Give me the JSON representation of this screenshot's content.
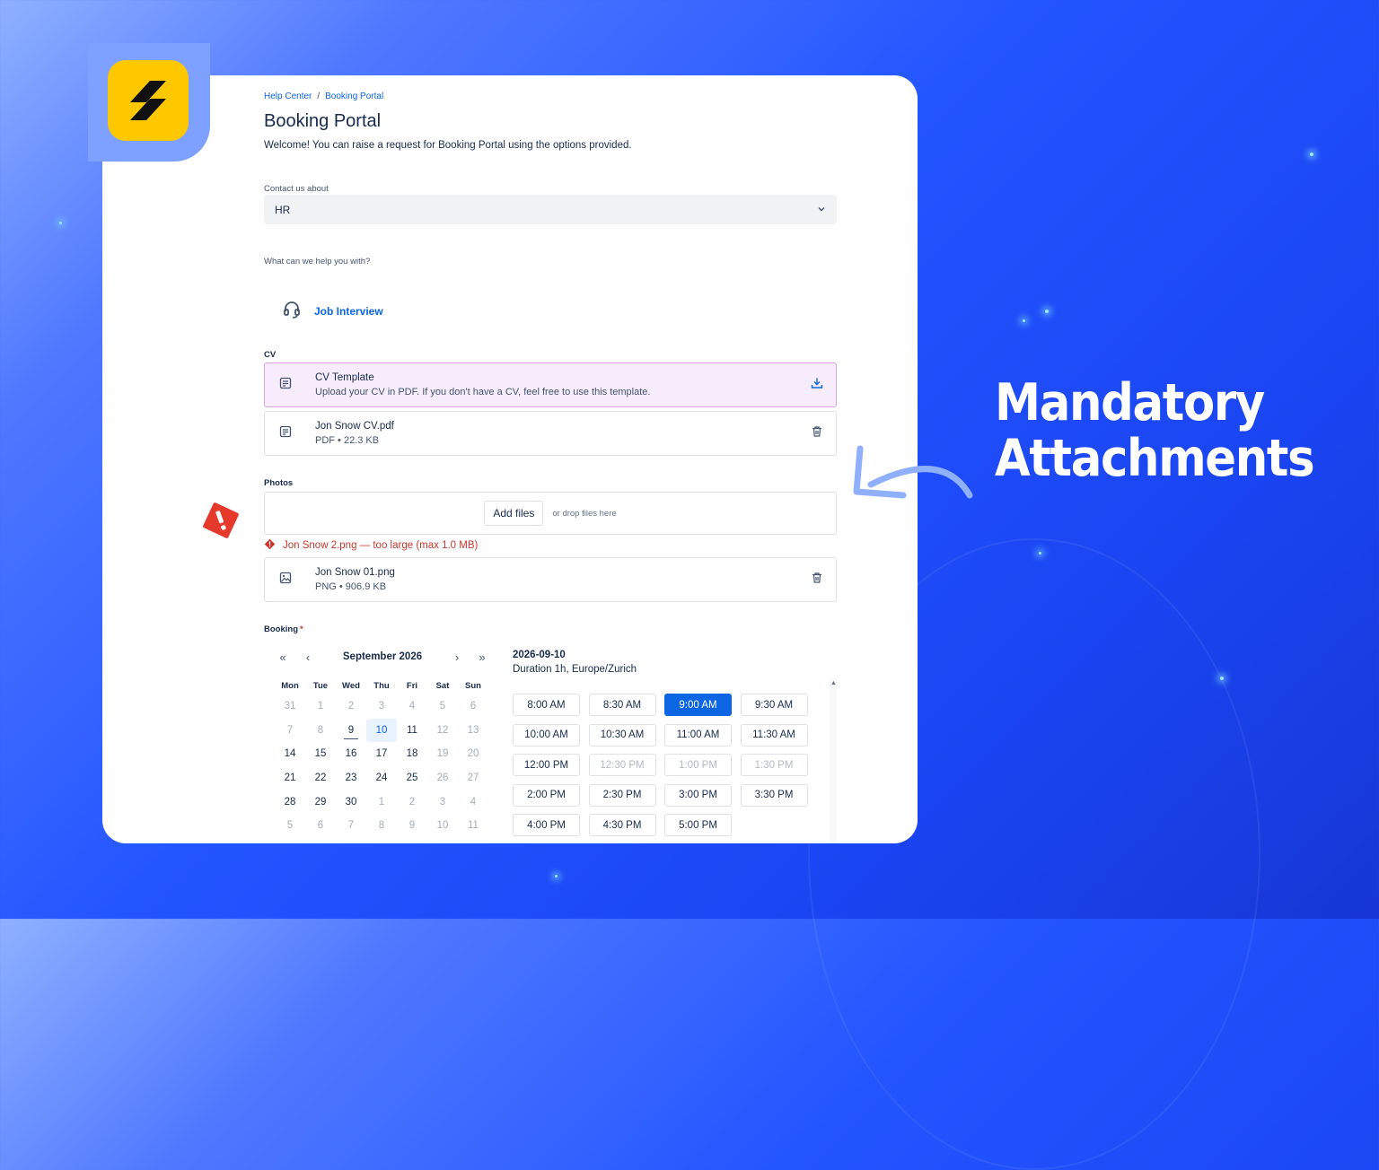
{
  "breadcrumbs": [
    "Help Center",
    "Booking Portal"
  ],
  "page": {
    "title": "Booking Portal",
    "welcome": "Welcome! You can raise a request for Booking Portal using the options provided."
  },
  "contact": {
    "label": "Contact us about",
    "value": "HR"
  },
  "help": {
    "label": "What can we help you with?",
    "request_type": "Job Interview",
    "icon": "headset-icon"
  },
  "cv": {
    "label": "CV",
    "template": {
      "name": "CV Template",
      "description": "Upload your CV in PDF. If you don't have a CV, feel free to use this template."
    },
    "file": {
      "name": "Jon Snow CV.pdf",
      "meta": "PDF • 22.3 KB"
    }
  },
  "photos": {
    "label": "Photos",
    "add_button": "Add files",
    "drop_hint": "or drop files here",
    "error": "Jon Snow 2.png — too large (max 1.0 MB)",
    "file": {
      "name": "Jon Snow 01.png",
      "meta": "PNG • 906.9 KB"
    }
  },
  "booking": {
    "label": "Booking",
    "required_mark": "*",
    "month": "September 2026",
    "nav": {
      "prev_year": "«",
      "prev_month": "‹",
      "next_month": "›",
      "next_year": "»"
    },
    "weekdays": [
      "Mon",
      "Tue",
      "Wed",
      "Thu",
      "Fri",
      "Sat",
      "Sun"
    ],
    "days": [
      {
        "d": "31",
        "s": "dim"
      },
      {
        "d": "1",
        "s": "dim"
      },
      {
        "d": "2",
        "s": "dim"
      },
      {
        "d": "3",
        "s": "dim"
      },
      {
        "d": "4",
        "s": "dim"
      },
      {
        "d": "5",
        "s": "dim"
      },
      {
        "d": "6",
        "s": "dim"
      },
      {
        "d": "7",
        "s": "dim"
      },
      {
        "d": "8",
        "s": "dim"
      },
      {
        "d": "9",
        "s": "today"
      },
      {
        "d": "10",
        "s": "sel"
      },
      {
        "d": "11",
        "s": ""
      },
      {
        "d": "12",
        "s": "dim"
      },
      {
        "d": "13",
        "s": "dim"
      },
      {
        "d": "14",
        "s": ""
      },
      {
        "d": "15",
        "s": ""
      },
      {
        "d": "16",
        "s": ""
      },
      {
        "d": "17",
        "s": ""
      },
      {
        "d": "18",
        "s": ""
      },
      {
        "d": "19",
        "s": "dim"
      },
      {
        "d": "20",
        "s": "dim"
      },
      {
        "d": "21",
        "s": ""
      },
      {
        "d": "22",
        "s": ""
      },
      {
        "d": "23",
        "s": ""
      },
      {
        "d": "24",
        "s": ""
      },
      {
        "d": "25",
        "s": ""
      },
      {
        "d": "26",
        "s": "dim"
      },
      {
        "d": "27",
        "s": "dim"
      },
      {
        "d": "28",
        "s": ""
      },
      {
        "d": "29",
        "s": ""
      },
      {
        "d": "30",
        "s": ""
      },
      {
        "d": "1",
        "s": "dim"
      },
      {
        "d": "2",
        "s": "dim"
      },
      {
        "d": "3",
        "s": "dim"
      },
      {
        "d": "4",
        "s": "dim"
      },
      {
        "d": "5",
        "s": "dim"
      },
      {
        "d": "6",
        "s": "dim"
      },
      {
        "d": "7",
        "s": "dim"
      },
      {
        "d": "8",
        "s": "dim"
      },
      {
        "d": "9",
        "s": "dim"
      },
      {
        "d": "10",
        "s": "dim"
      },
      {
        "d": "11",
        "s": "dim"
      }
    ],
    "selected_date": "2026-09-10",
    "duration": "Duration 1h, Europe/Zurich",
    "slots": [
      {
        "t": "8:00 AM",
        "s": ""
      },
      {
        "t": "8:30 AM",
        "s": ""
      },
      {
        "t": "9:00 AM",
        "s": "on"
      },
      {
        "t": "9:30 AM",
        "s": ""
      },
      {
        "t": "10:00 AM",
        "s": ""
      },
      {
        "t": "10:30 AM",
        "s": ""
      },
      {
        "t": "11:00 AM",
        "s": ""
      },
      {
        "t": "11:30 AM",
        "s": ""
      },
      {
        "t": "12:00 PM",
        "s": ""
      },
      {
        "t": "12:30 PM",
        "s": "dis"
      },
      {
        "t": "1:00 PM",
        "s": "dis"
      },
      {
        "t": "1:30 PM",
        "s": "dis"
      },
      {
        "t": "2:00 PM",
        "s": ""
      },
      {
        "t": "2:30 PM",
        "s": ""
      },
      {
        "t": "3:00 PM",
        "s": ""
      },
      {
        "t": "3:30 PM",
        "s": ""
      },
      {
        "t": "4:00 PM",
        "s": ""
      },
      {
        "t": "4:30 PM",
        "s": ""
      },
      {
        "t": "5:00 PM",
        "s": ""
      }
    ]
  },
  "headline": [
    "Mandatory",
    "Attachments"
  ],
  "colors": {
    "accent": "#0c66e4",
    "error": "#c9372c",
    "logo": "#fdc800",
    "warning_badge": "#e5392b"
  }
}
